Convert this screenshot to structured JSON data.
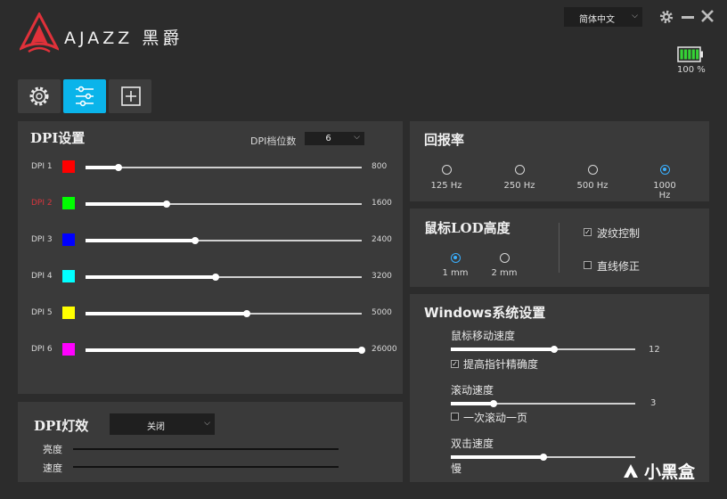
{
  "header": {
    "brand_text": "AJAZZ 黑爵",
    "language": "简体中文",
    "battery_percent": "100 %",
    "battery_level": 1.0
  },
  "tabs": [
    {
      "icon": "gear-icon"
    },
    {
      "icon": "sliders-icon",
      "active": true
    },
    {
      "icon": "add-macro-icon"
    }
  ],
  "dpi": {
    "title": "DPI设置",
    "levels_label": "DPI档位数",
    "levels_value": "6",
    "max": 26000,
    "rows": [
      {
        "label": "DPI 1",
        "color": "#ff0000",
        "value": "800",
        "numeric": 800,
        "selected": false
      },
      {
        "label": "DPI 2",
        "color": "#00ff00",
        "value": "1600",
        "numeric": 1600,
        "selected": true
      },
      {
        "label": "DPI 3",
        "color": "#0000ff",
        "value": "2400",
        "numeric": 2400,
        "selected": false
      },
      {
        "label": "DPI 4",
        "color": "#00ffff",
        "value": "3200",
        "numeric": 3200,
        "selected": false
      },
      {
        "label": "DPI 5",
        "color": "#ffff00",
        "value": "5000",
        "numeric": 5000,
        "selected": false
      },
      {
        "label": "DPI 6",
        "color": "#ff00ff",
        "value": "26000",
        "numeric": 26000,
        "selected": false
      }
    ]
  },
  "light": {
    "title": "DPI灯效",
    "mode": "关闭",
    "brightness_label": "亮度",
    "speed_label": "速度"
  },
  "polling": {
    "title": "回报率",
    "options": [
      "125 Hz",
      "250 Hz",
      "500 Hz",
      "1000 Hz"
    ],
    "selected": 3
  },
  "lod": {
    "title": "鼠标LOD高度",
    "options": [
      "1 mm",
      "2 mm"
    ],
    "selected": 0,
    "ripple_label": "波纹控制",
    "ripple_checked": true,
    "angle_label": "直线修正",
    "angle_checked": false
  },
  "windows": {
    "title": "Windows系统设置",
    "move_label": "鼠标移动速度",
    "move_value": "12",
    "move_fraction": 0.56,
    "precision_label": "提高指针精确度",
    "precision_checked": true,
    "scroll_label": "滚动速度",
    "scroll_value": "3",
    "scroll_fraction": 0.23,
    "page_label": "一次滚动一页",
    "page_checked": false,
    "dbl_label": "双击速度",
    "dbl_slow": "慢",
    "dbl_fraction": 0.5
  },
  "watermark": "小黑盒",
  "colors": {
    "accent": "#0ab4ea",
    "radio_on": "#3ab0ff",
    "logo": "#e0313a",
    "battery": "#35d335"
  }
}
